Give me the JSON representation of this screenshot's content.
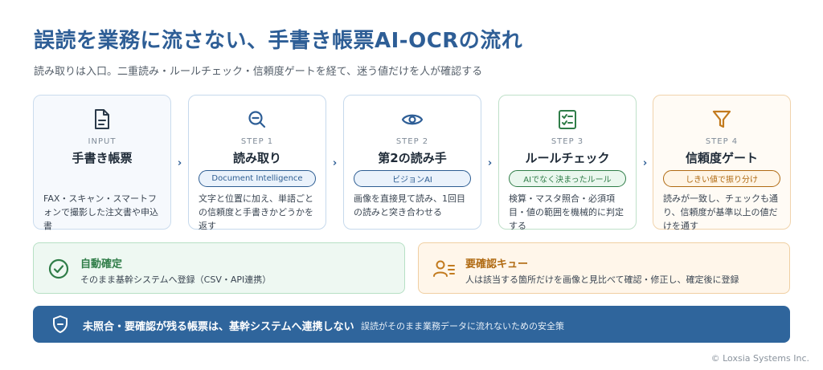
{
  "header": {
    "title": "誤読を業務に流さない、手書き帳票AI-OCRの流れ",
    "subtitle": "読み取りは入口。二重読み・ルールチェック・信頼度ゲートを経て、迷う値だけを人が確認する"
  },
  "steps": [
    {
      "label": "INPUT",
      "name": "手書き帳票",
      "tag": "",
      "icon": "document-icon",
      "desc": "FAX・スキャン・スマートフォンで撮影した注文書や申込書"
    },
    {
      "label": "STEP 1",
      "name": "読み取り",
      "tag": "Document Intelligence",
      "icon": "search-icon",
      "desc": "文字と位置に加え、単語ごとの信頼度と手書きかどうかを返す"
    },
    {
      "label": "STEP 2",
      "name": "第2の読み手",
      "tag": "ビジョンAI",
      "icon": "eye-icon",
      "desc": "画像を直接見て読み、1回目の読みと突き合わせる"
    },
    {
      "label": "STEP 3",
      "name": "ルールチェック",
      "tag": "AIでなく決まったルール",
      "icon": "checklist-icon",
      "desc": "検算・マスタ照合・必須項目・値の範囲を機械的に判定する"
    },
    {
      "label": "STEP 4",
      "name": "信頼度ゲート",
      "tag": "しきい値で振り分け",
      "icon": "filter-icon",
      "desc": "読みが一致し、チェックも通り、信頼度が基準以上の値だけを通す"
    }
  ],
  "arrow_glyph": "›",
  "outcomes": {
    "auto": {
      "title": "自動確定",
      "desc": "そのまま基幹システムへ登録（CSV・API連携）",
      "icon": "check-circle-icon"
    },
    "queue": {
      "title": "要確認キュー",
      "desc": "人は該当する箇所だけを画像と見比べて確認・修正し、確定後に登録",
      "icon": "user-review-icon"
    }
  },
  "banner": {
    "title": "未照合・要確認が残る帳票は、基幹システムへ連携しない",
    "desc": "誤読がそのまま業務データに流れないための安全策",
    "icon": "shield-icon"
  },
  "footer": {
    "copyright": "© Loxsia Systems Inc."
  },
  "colors": {
    "primary": "#2e5e96",
    "green": "#2f7d48",
    "orange": "#c27a1e",
    "banner": "#2f659c"
  }
}
